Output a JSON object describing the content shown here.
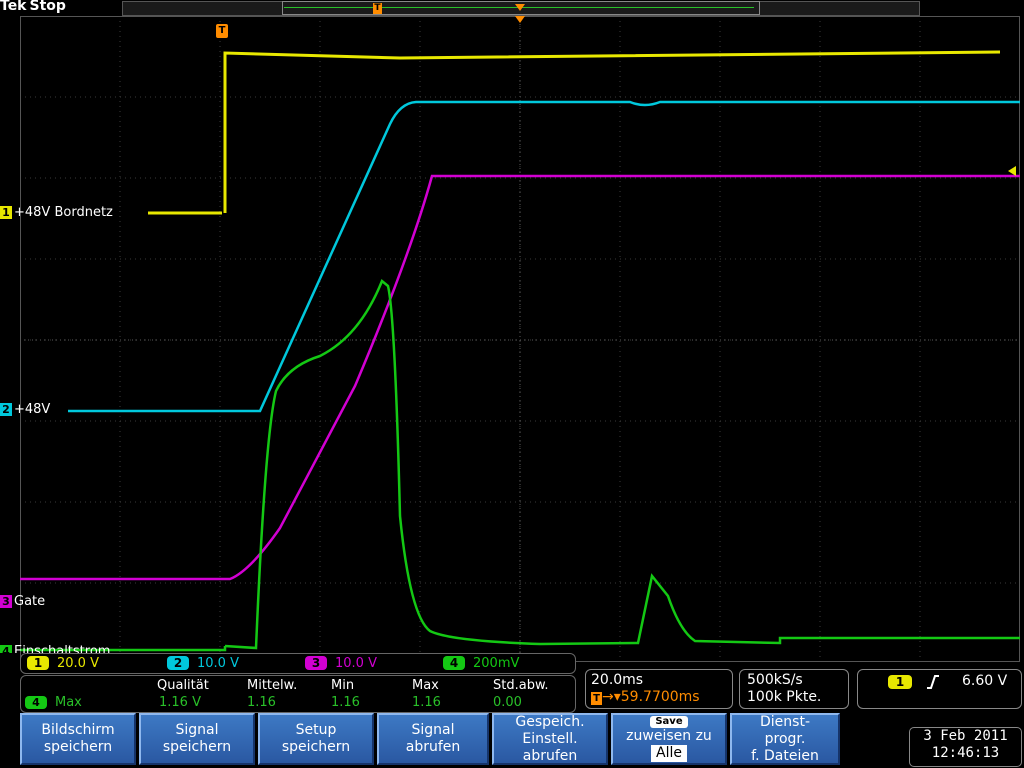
{
  "brand": {
    "name": "Tek",
    "state": "Stop"
  },
  "trigger_marker": "T",
  "channels": [
    {
      "id": "1",
      "label": "+48V Bordnetz",
      "color": "#e8e800"
    },
    {
      "id": "2",
      "label": "+48V",
      "color": "#00c8dc"
    },
    {
      "id": "3",
      "label": "Gate",
      "color": "#d200d2"
    },
    {
      "id": "4",
      "label": "Einschaltstrom",
      "color": "#14c814"
    }
  ],
  "scales": [
    {
      "id": "1",
      "value": "20.0 V",
      "color": "#e8e800"
    },
    {
      "id": "2",
      "value": "10.0 V",
      "color": "#00c8dc"
    },
    {
      "id": "3",
      "value": "10.0 V",
      "color": "#d200d2"
    },
    {
      "id": "4",
      "value": "200mV",
      "color": "#14c814"
    }
  ],
  "measurement": {
    "source": "4",
    "type": "Max",
    "headers": [
      "Qualität",
      "Mittelw.",
      "Min",
      "Max",
      "Std.abw."
    ],
    "values": [
      "1.16 V",
      "1.16",
      "1.16",
      "1.16",
      "0.00"
    ]
  },
  "timebase": {
    "scale": "20.0ms",
    "position": "59.7700ms"
  },
  "acquisition": {
    "rate": "500kS/s",
    "points": "100k Pkte."
  },
  "trigger": {
    "source": "1",
    "slope": "rising",
    "level": "6.60 V"
  },
  "buttons": [
    {
      "line1": "Bildschirm",
      "line2": "speichern"
    },
    {
      "line1": "Signal",
      "line2": "speichern"
    },
    {
      "line1": "Setup",
      "line2": "speichern"
    },
    {
      "line1": "Signal",
      "line2": "abrufen"
    },
    {
      "line1": "Gespeich.",
      "line2": "Einstell.",
      "line3": "abrufen"
    },
    {
      "badge": "Save",
      "line1": "zuweisen zu",
      "line2": "Alle"
    },
    {
      "line1": "Dienst-",
      "line2": "progr.",
      "line3": "f. Dateien"
    }
  ],
  "datetime": {
    "date": "3 Feb 2011",
    "time": "12:46:13"
  }
}
